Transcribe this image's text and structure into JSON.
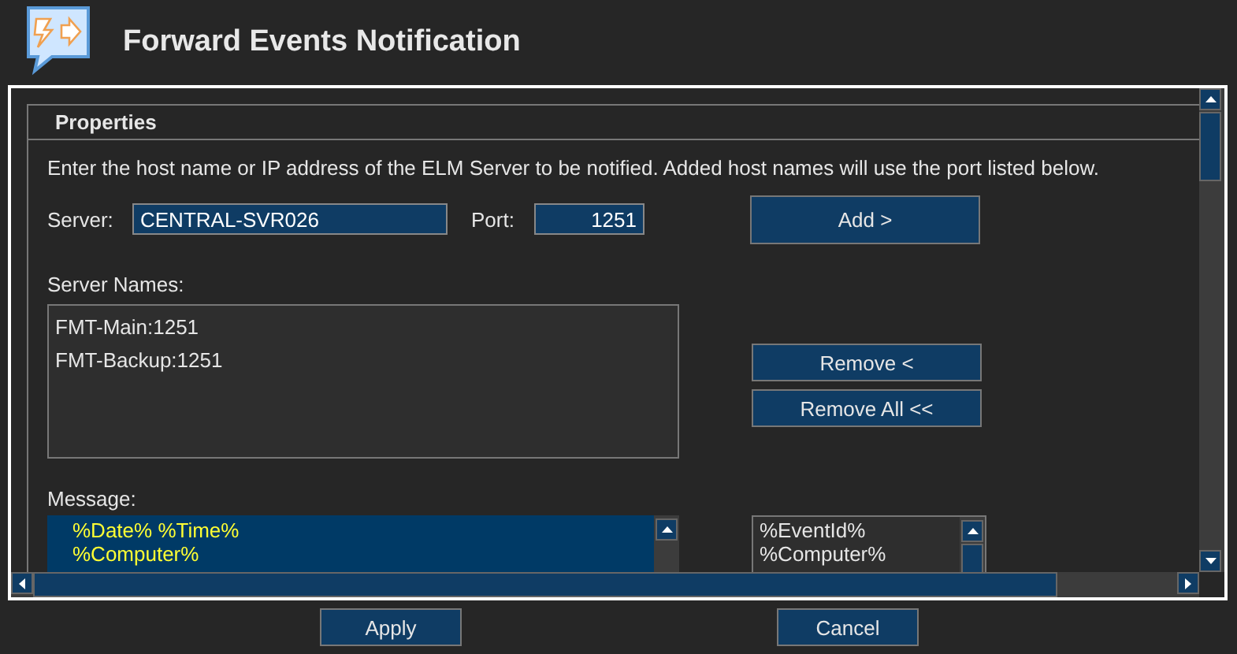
{
  "window": {
    "title": "Forward Events Notification"
  },
  "properties": {
    "heading": "Properties",
    "description": "Enter the host name or IP address of the ELM Server to be notified. Added host names will use the port listed below.",
    "server": {
      "label": "Server:",
      "value": "CENTRAL-SVR026"
    },
    "port": {
      "label": "Port:",
      "value": "1251"
    },
    "add_button": "Add >",
    "server_names": {
      "label": "Server Names:",
      "items": [
        {
          "text": "FMT-Main:1251"
        },
        {
          "text": "FMT-Backup:1251"
        }
      ]
    },
    "remove_button": "Remove <",
    "remove_all_button": "Remove All <<",
    "message": {
      "label": "Message:",
      "lines": [
        "%Date% %Time%",
        "%Computer%"
      ]
    },
    "tokens": [
      "%EventId%",
      "%Computer%"
    ]
  },
  "buttons": [
    "Apply",
    "Cancel"
  ]
}
